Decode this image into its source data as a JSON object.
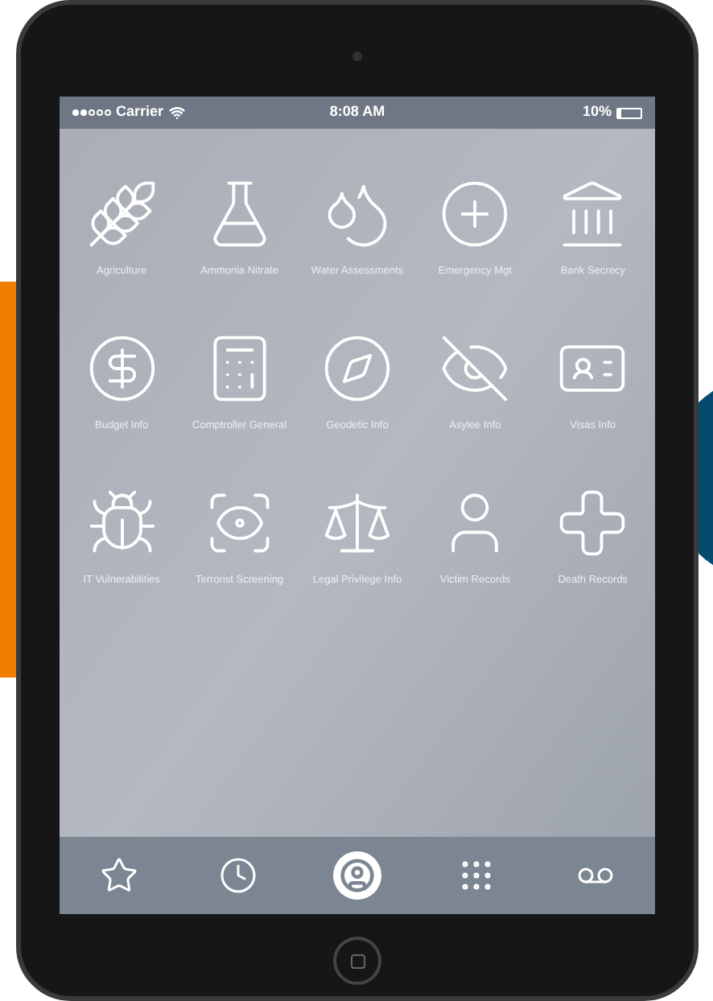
{
  "status_bar": {
    "carrier": "Carrier",
    "time": "8:08 AM",
    "battery": "10%"
  },
  "apps": [
    {
      "label": "Agriculture"
    },
    {
      "label": "Ammonia Nitrate"
    },
    {
      "label": "Water Assessments"
    },
    {
      "label": "Emergency Mgt"
    },
    {
      "label": "Bank Secrecy"
    },
    {
      "label": "Budget Info"
    },
    {
      "label": "Comptroller General"
    },
    {
      "label": "Geodetic Info"
    },
    {
      "label": "Asylee Info"
    },
    {
      "label": "Visas Info"
    },
    {
      "label": "IT Vulnerabilities"
    },
    {
      "label": "Terrorist Screening"
    },
    {
      "label": "Legal Privilege Info"
    },
    {
      "label": "Victim Records"
    },
    {
      "label": "Death Records"
    }
  ],
  "tab_bar": [
    {
      "selected": false
    },
    {
      "selected": false
    },
    {
      "selected": true
    },
    {
      "selected": false
    },
    {
      "selected": false
    }
  ]
}
